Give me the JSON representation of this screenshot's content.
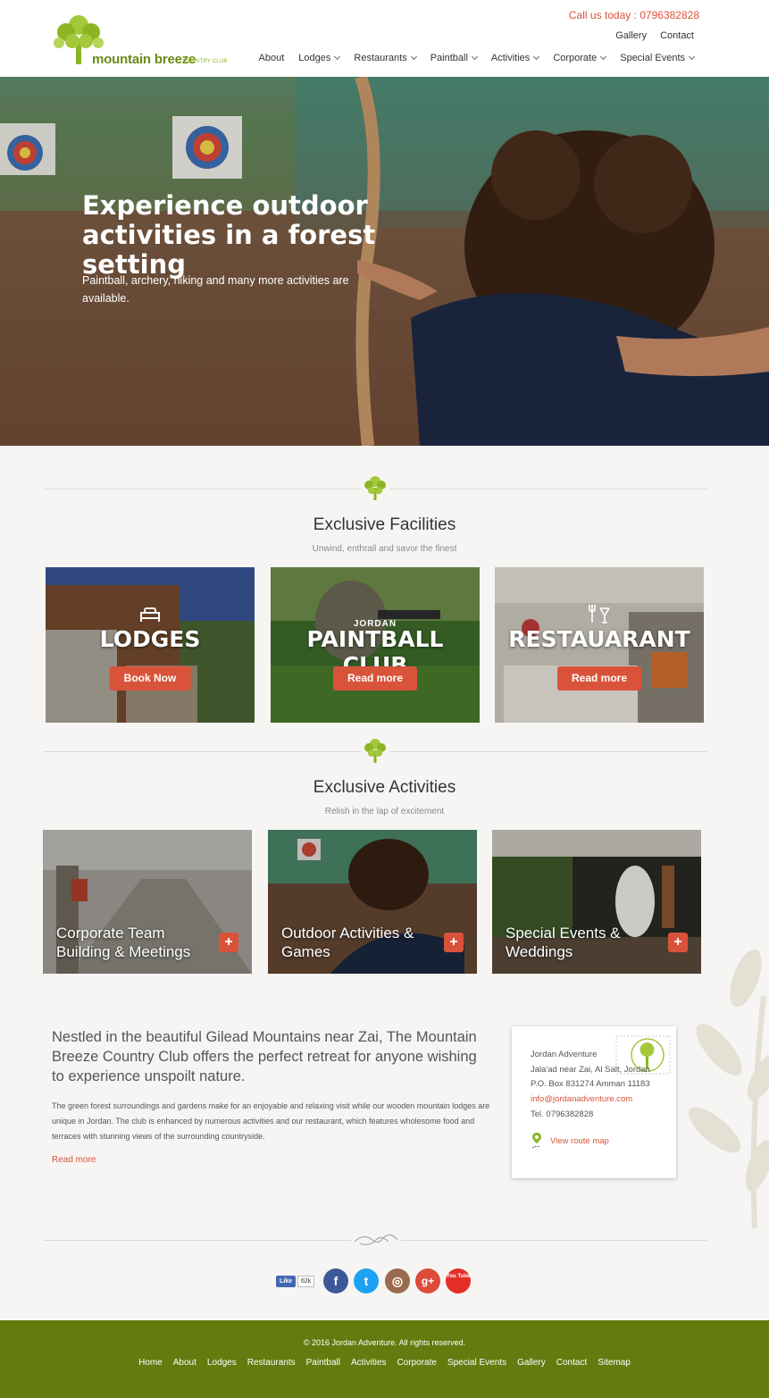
{
  "header": {
    "logo_main": "mountain breeze",
    "logo_sub": "COUNTRY CLUB",
    "call": "Call us today : 0796382828",
    "util_links": [
      "Gallery",
      "Contact"
    ],
    "nav": [
      "About",
      "Lodges",
      "Restaurants",
      "Paintball",
      "Activities",
      "Corporate",
      "Special Events"
    ]
  },
  "hero": {
    "title": "Experience outdoor activities in a forest setting",
    "text": "Paintball, archery, hiking and many more activities are available."
  },
  "facilities": {
    "title": "Exclusive Facilities",
    "subtitle": "Unwind, enthrall and savor the finest",
    "cards": [
      {
        "name": "LODGES",
        "button": "Book Now"
      },
      {
        "pre": "JORDAN",
        "name": "PAINTBALL CLUB",
        "button": "Read more"
      },
      {
        "name": "RESTAUARANT",
        "button": "Read more"
      }
    ]
  },
  "activities": {
    "title": "Exclusive Activities",
    "subtitle": "Relish in the lap of excitement",
    "items": [
      {
        "label": "Corporate Team Building & Meetings",
        "plus": "+"
      },
      {
        "label": "Outdoor Activities & Games",
        "plus": "+"
      },
      {
        "label": "Special Events & Weddings",
        "plus": "+"
      }
    ]
  },
  "about": {
    "heading": "Nestled in the beautiful Gilead Mountains near Zai, The Mountain Breeze Country Club offers the perfect retreat for anyone wishing to experience unspoilt nature.",
    "body": "The green forest surroundings and gardens make for an enjoyable and relaxing visit while our wooden mountain lodges are unique in Jordan. The club is enhanced by numerous activities and our restaurant, which features wholesome food and terraces with stunning views of the surrounding countryside.",
    "read_more": "Read more"
  },
  "contact": {
    "name": "Jordan Adventure",
    "address1": "Jala'ad near Zai, Al Salt, Jordan",
    "address2": "P.O. Box 831274 Amman 11183",
    "email": "info@jordanadventure.com",
    "tel": "Tel. 0796382828",
    "route": "View route map"
  },
  "social": {
    "like": "Like",
    "like_count": "62k",
    "facebook": "f",
    "twitter": "t",
    "instagram": "◎",
    "gplus": "g+",
    "youtube": "You Tube"
  },
  "footer": {
    "copyright": "© 2016 Jordan Adventure. All rights reserved.",
    "links": [
      "Home",
      "About",
      "Lodges",
      "Restaurants",
      "Paintball",
      "Activities",
      "Corporate",
      "Special Events",
      "Gallery",
      "Contact",
      "Sitemap"
    ]
  },
  "colors": {
    "accent": "#d9533a",
    "brand_green": "#637b0f",
    "logo_green": "#8cb524"
  }
}
